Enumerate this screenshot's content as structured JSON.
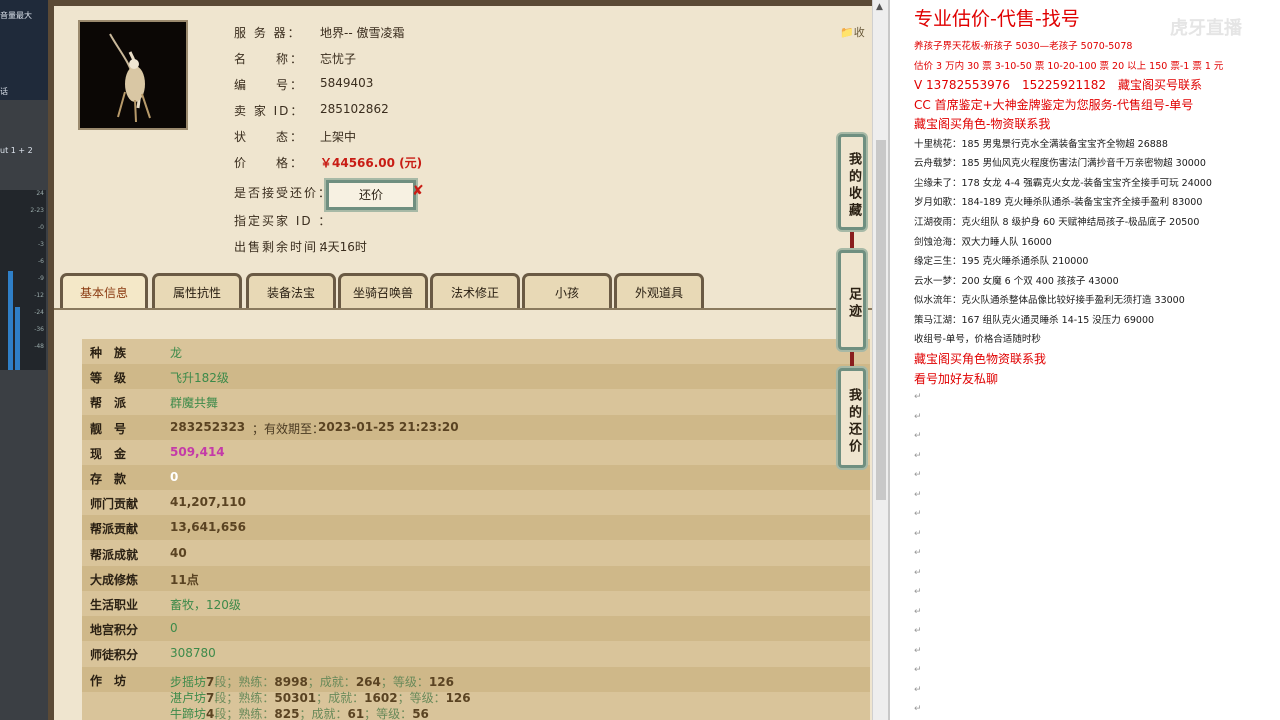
{
  "mixer": {
    "top_label": "音量最大",
    "mid_label": "话",
    "out_label": "ut 1 + 2",
    "scale": [
      "24",
      "2-23",
      "-0",
      "-3",
      "-6",
      "-9",
      "-12",
      "-24",
      "-36",
      "-48"
    ],
    "levels": [
      0.55,
      0.35
    ]
  },
  "game": {
    "collect_label": "收",
    "info": [
      {
        "key": "服 务 器：",
        "value": "地界-- 傲雪凌霜"
      },
      {
        "key": "名　　称：",
        "value": "忘忧子"
      },
      {
        "key": "编　　号：",
        "value": "5849403"
      },
      {
        "key": "卖 家 ID：",
        "value": "285102862"
      },
      {
        "key": "状　　态：",
        "value": "上架中"
      },
      {
        "key": "价　　格：",
        "value": "￥44566.00 (元)"
      },
      {
        "key": "是否接受还价：",
        "value": ""
      },
      {
        "key": "指定买家 ID ：",
        "value": ""
      },
      {
        "key": "出售剩余时间：",
        "value": "4天16时"
      }
    ],
    "offer_button": "还价",
    "offer_close": "✘",
    "tabs": [
      "基本信息",
      "属性抗性",
      "装备法宝",
      "坐骑召唤兽",
      "法术修正",
      "小孩",
      "外观道具"
    ],
    "side_buttons": [
      "我的收藏",
      "足迹",
      "我的还价"
    ],
    "stats": [
      {
        "key": "种　族",
        "value": "龙"
      },
      {
        "key": "等　级",
        "value": "飞升182级"
      },
      {
        "key": "帮　派",
        "value": "群魔共舞"
      },
      {
        "key": "靓　号",
        "value": "283252323",
        "extra": "；有效期至：",
        "date": "2023-01-25 21:23:20"
      },
      {
        "key": "现　金",
        "value": "509,414"
      },
      {
        "key": "存　款",
        "value": "0"
      },
      {
        "key": "师门贡献",
        "value": "41,207,110"
      },
      {
        "key": "帮派贡献",
        "value": "13,641,656"
      },
      {
        "key": "帮派成就",
        "value": "40"
      },
      {
        "key": "大成修炼",
        "value": "11点"
      },
      {
        "key": "生活职业",
        "value": "畜牧，120级"
      },
      {
        "key": "地宫积分",
        "value": "0"
      },
      {
        "key": "师徒积分",
        "value": "308780"
      },
      {
        "key": "作　坊",
        "value": ""
      }
    ],
    "workshops": [
      {
        "name": "步摇坊",
        "seg": "7",
        "l1": "段；熟练：",
        "v1": "8998",
        "l2": "；成就：",
        "v2": "264",
        "l3": "；等级：",
        "v3": "126"
      },
      {
        "name": "湛卢坊",
        "seg": "7",
        "l1": "段；熟练：",
        "v1": "50301",
        "l2": "；成就：",
        "v2": "1602",
        "l3": "；等级：",
        "v3": "126"
      },
      {
        "name": "牛蹄坊",
        "seg": "4",
        "l1": "段；熟练：",
        "v1": "825",
        "l2": "；成就：",
        "v2": "61",
        "l3": "；等级：",
        "v3": "56"
      }
    ]
  },
  "doc": {
    "watermark": "虎牙直播",
    "lines": [
      {
        "style": "h",
        "text": "专业估价-代售-找号"
      },
      {
        "style": "r",
        "text": "养孩子界天花板-新孩子 5030—老孩子 5070-5078"
      },
      {
        "style": "r",
        "text": "估价 3 万内 30 票 3-10-50 票 10-20-100 票 20 以上 150 票-1 票 1 元"
      },
      {
        "style": "rl",
        "text": "V 13782553976　15225921182　藏宝阁买号联系"
      },
      {
        "style": "rl",
        "text": "CC 首席鉴定+大神金牌鉴定为您服务-代售组号-单号"
      },
      {
        "style": "rl",
        "text": "藏宝阁买角色-物资联系我"
      },
      {
        "style": "b",
        "text": "十里桃花：185 男鬼景行克水全满装备宝宝齐全物超 26888"
      },
      {
        "style": "b",
        "text": "云舟载梦：185 男仙风克火程度伤害法门满抄音千万亲密物超 30000"
      },
      {
        "style": "b",
        "text": "尘缘未了：178 女龙 4-4 强霸克火女龙-装备宝宝齐全接手可玩 24000"
      },
      {
        "style": "b",
        "text": "岁月如歌：184-189 克火睡杀队通杀-装备宝宝齐全接手盈利 83000"
      },
      {
        "style": "b",
        "text": "江湖夜雨：克火组队 8 级护身 60 天赋神结局孩子-极品底子 20500"
      },
      {
        "style": "b",
        "text": "剑蚀沧海：双大力睡人队 16000"
      },
      {
        "style": "b",
        "text": "缘定三生：195 克火睡杀通杀队 210000"
      },
      {
        "style": "b",
        "text": "云水一梦：200 女魔 6 个双 400 孩孩子 43000"
      },
      {
        "style": "b",
        "text": "似水流年：克火队通杀整体品像比较好接手盈利无须打造 33000"
      },
      {
        "style": "b",
        "text": "策马江湖：167 组队克火通灵睡杀 14-15 没压力 69000"
      },
      {
        "style": "b",
        "text": "收组号-单号，价格合适随时秒"
      },
      {
        "style": "rl",
        "text": "藏宝阁买角色物资联系我"
      },
      {
        "style": "rl",
        "text": "看号加好友私聊"
      }
    ],
    "para_mark": "↵"
  }
}
